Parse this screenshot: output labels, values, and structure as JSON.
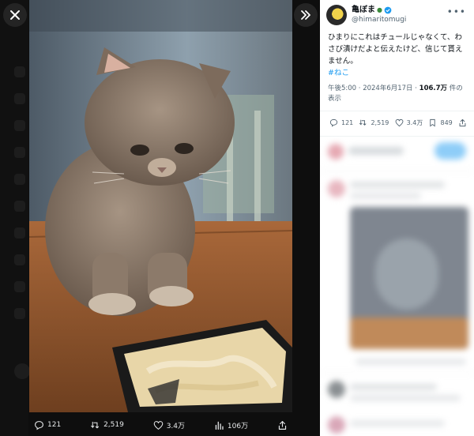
{
  "media_viewer": {
    "close_icon": "close-icon",
    "expand_icon": "chevrons-right-icon",
    "actions": {
      "replies": "121",
      "reposts": "2,519",
      "likes": "3.4万",
      "views": "106万"
    }
  },
  "post": {
    "display_name": "亀ぼま",
    "handle": "@himaritomugi",
    "text": "ひまりにこれはチュールじゃなくて、わさび漬けだよと伝えたけど、信じて貰えません。",
    "hashtag": "#ねこ",
    "time": "午後5:00",
    "date": "2024年6月17日",
    "views_count": "106.7万",
    "views_suffix": "件の表示",
    "stats": {
      "replies": "121",
      "reposts": "2,519",
      "likes": "3.4万",
      "bookmarks": "849"
    }
  },
  "colors": {
    "accent": "#1d9bf0",
    "text": "#0f1419",
    "muted": "#536471"
  }
}
